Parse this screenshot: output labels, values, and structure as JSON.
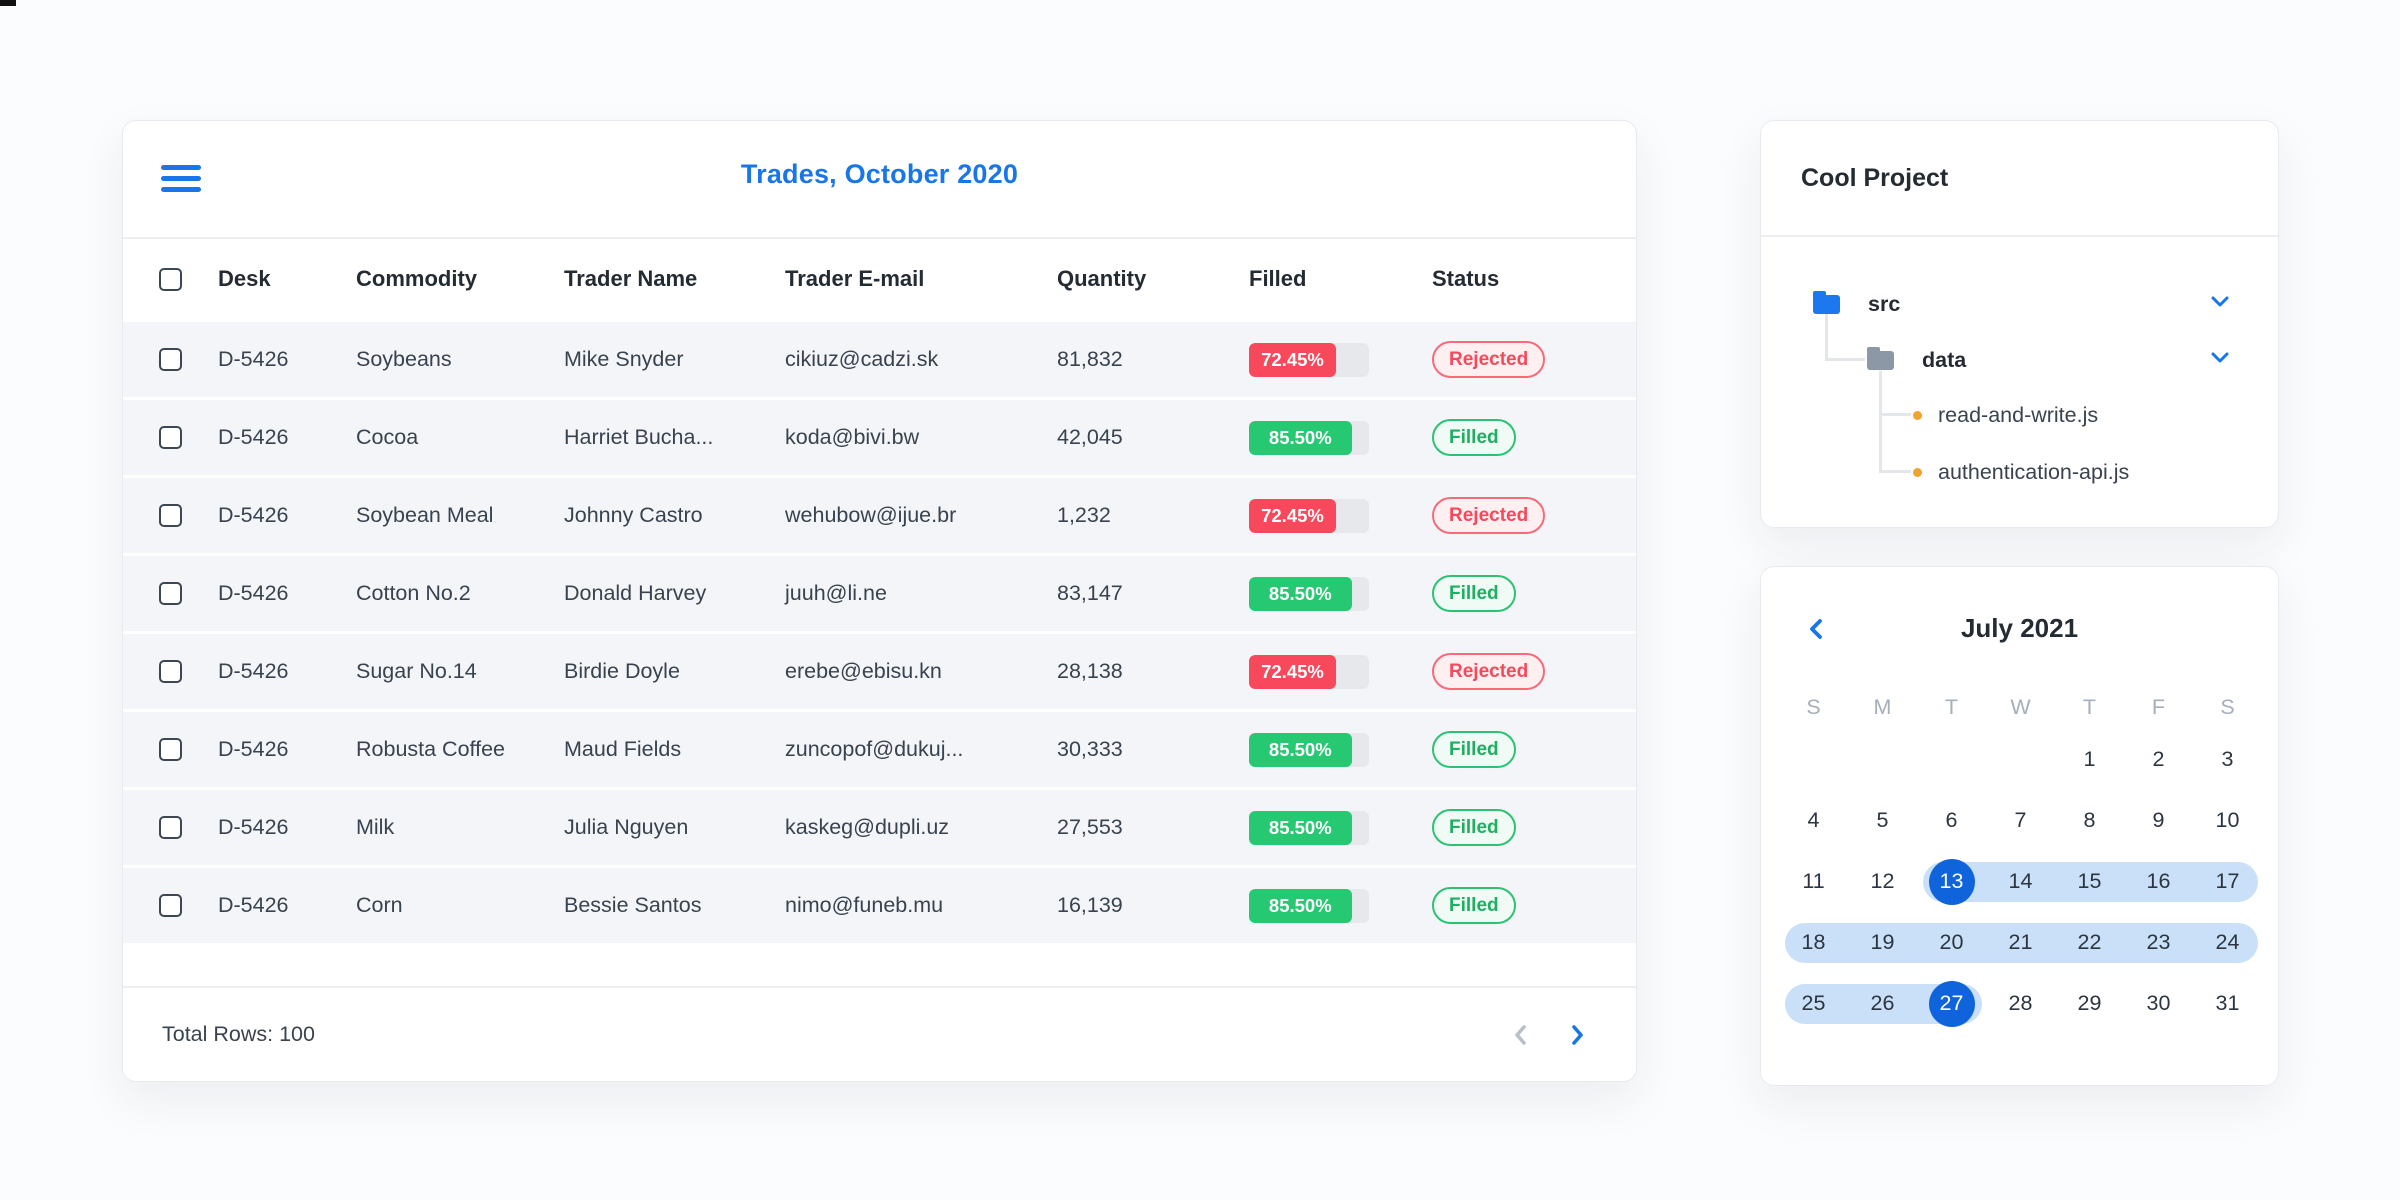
{
  "trades": {
    "title": "Trades, October 2020",
    "columns": [
      "Desk",
      "Commodity",
      "Trader Name",
      "Trader E-mail",
      "Quantity",
      "Filled",
      "Status"
    ],
    "rows": [
      {
        "desk": "D-5426",
        "commodity": "Soybeans",
        "trader": "Mike Snyder",
        "email": "cikiuz@cadzi.sk",
        "quantity": "81,832",
        "filled_label": "72.45%",
        "filled_value": 72.45,
        "status": "Rejected"
      },
      {
        "desk": "D-5426",
        "commodity": "Cocoa",
        "trader": "Harriet Bucha...",
        "email": "koda@bivi.bw",
        "quantity": "42,045",
        "filled_label": "85.50%",
        "filled_value": 85.5,
        "status": "Filled"
      },
      {
        "desk": "D-5426",
        "commodity": "Soybean Meal",
        "trader": "Johnny Castro",
        "email": "wehubow@ijue.br",
        "quantity": "1,232",
        "filled_label": "72.45%",
        "filled_value": 72.45,
        "status": "Rejected"
      },
      {
        "desk": "D-5426",
        "commodity": "Cotton No.2",
        "trader": "Donald Harvey",
        "email": "juuh@li.ne",
        "quantity": "83,147",
        "filled_label": "85.50%",
        "filled_value": 85.5,
        "status": "Filled"
      },
      {
        "desk": "D-5426",
        "commodity": "Sugar No.14",
        "trader": "Birdie Doyle",
        "email": "erebe@ebisu.kn",
        "quantity": "28,138",
        "filled_label": "72.45%",
        "filled_value": 72.45,
        "status": "Rejected"
      },
      {
        "desk": "D-5426",
        "commodity": "Robusta Coffee",
        "trader": "Maud Fields",
        "email": "zuncopof@dukuj...",
        "quantity": "30,333",
        "filled_label": "85.50%",
        "filled_value": 85.5,
        "status": "Filled"
      },
      {
        "desk": "D-5426",
        "commodity": "Milk",
        "trader": "Julia Nguyen",
        "email": "kaskeg@dupli.uz",
        "quantity": "27,553",
        "filled_label": "85.50%",
        "filled_value": 85.5,
        "status": "Filled"
      },
      {
        "desk": "D-5426",
        "commodity": "Corn",
        "trader": "Bessie Santos",
        "email": "nimo@funeb.mu",
        "quantity": "16,139",
        "filled_label": "85.50%",
        "filled_value": 85.5,
        "status": "Filled"
      }
    ],
    "footer": {
      "total": "Total Rows: 100"
    }
  },
  "project": {
    "title": "Cool Project",
    "tree": {
      "root_folder": {
        "label": "src"
      },
      "sub_folder": {
        "label": "data"
      },
      "files": [
        {
          "label": "read-and-write.js"
        },
        {
          "label": "authentication-api.js"
        }
      ]
    }
  },
  "calendar": {
    "title": "July 2021",
    "weekdays": [
      "S",
      "M",
      "T",
      "W",
      "T",
      "F",
      "S"
    ],
    "weeks": [
      [
        "",
        "",
        "",
        "",
        "1",
        "2",
        "3"
      ],
      [
        "4",
        "5",
        "6",
        "7",
        "8",
        "9",
        "10"
      ],
      [
        "11",
        "12",
        "13",
        "14",
        "15",
        "16",
        "17"
      ],
      [
        "18",
        "19",
        "20",
        "21",
        "22",
        "23",
        "24"
      ],
      [
        "25",
        "26",
        "27",
        "28",
        "29",
        "30",
        "31"
      ]
    ],
    "selected_range": {
      "start_day": "13",
      "end_day": "27"
    }
  },
  "colors": {
    "accent_blue": "#1876e9",
    "selected_day_blue": "#0f64dc",
    "range_band_blue": "#c9e0f8",
    "rejected_red": "#f8485c",
    "filled_green": "#26c871"
  }
}
